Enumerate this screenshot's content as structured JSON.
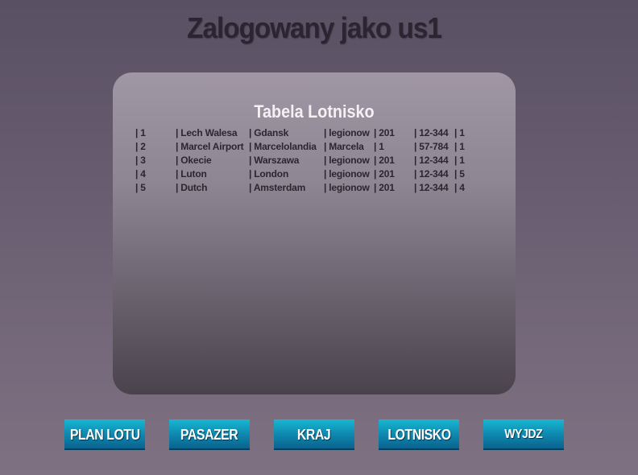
{
  "header": {
    "title": "Zalogowany jako us1"
  },
  "panel": {
    "title": "Tabela Lotnisko",
    "rows": [
      [
        "| 1",
        "| Lech Walesa",
        "| Gdansk",
        "| legionow",
        "| 201",
        "| 12-344",
        "| 1"
      ],
      [
        "| 2",
        "| Marcel Airport",
        "| Marcelolandia",
        "| Marcela",
        "| 1",
        "| 57-784",
        "| 1"
      ],
      [
        "| 3",
        "| Okecie",
        "| Warszawa",
        "| legionow",
        "| 201",
        "| 12-344",
        "| 1"
      ],
      [
        "| 4",
        "| Luton",
        "| London",
        "| legionow",
        "| 201",
        "| 12-344",
        "| 5"
      ],
      [
        "| 5",
        "| Dutch",
        "| Amsterdam",
        "| legionow",
        "| 201",
        "| 12-344",
        "| 4"
      ]
    ]
  },
  "nav": {
    "buttons": [
      "PLAN LOTU",
      "PASAZER",
      "KRAJ",
      "LOTNISKO",
      "WYJDZ"
    ]
  },
  "colors": {
    "button_top": "#19b6d2",
    "button_bottom": "#0a5e8a",
    "title_text": "#2a2530",
    "panel_title_text": "#f4f1f5"
  }
}
